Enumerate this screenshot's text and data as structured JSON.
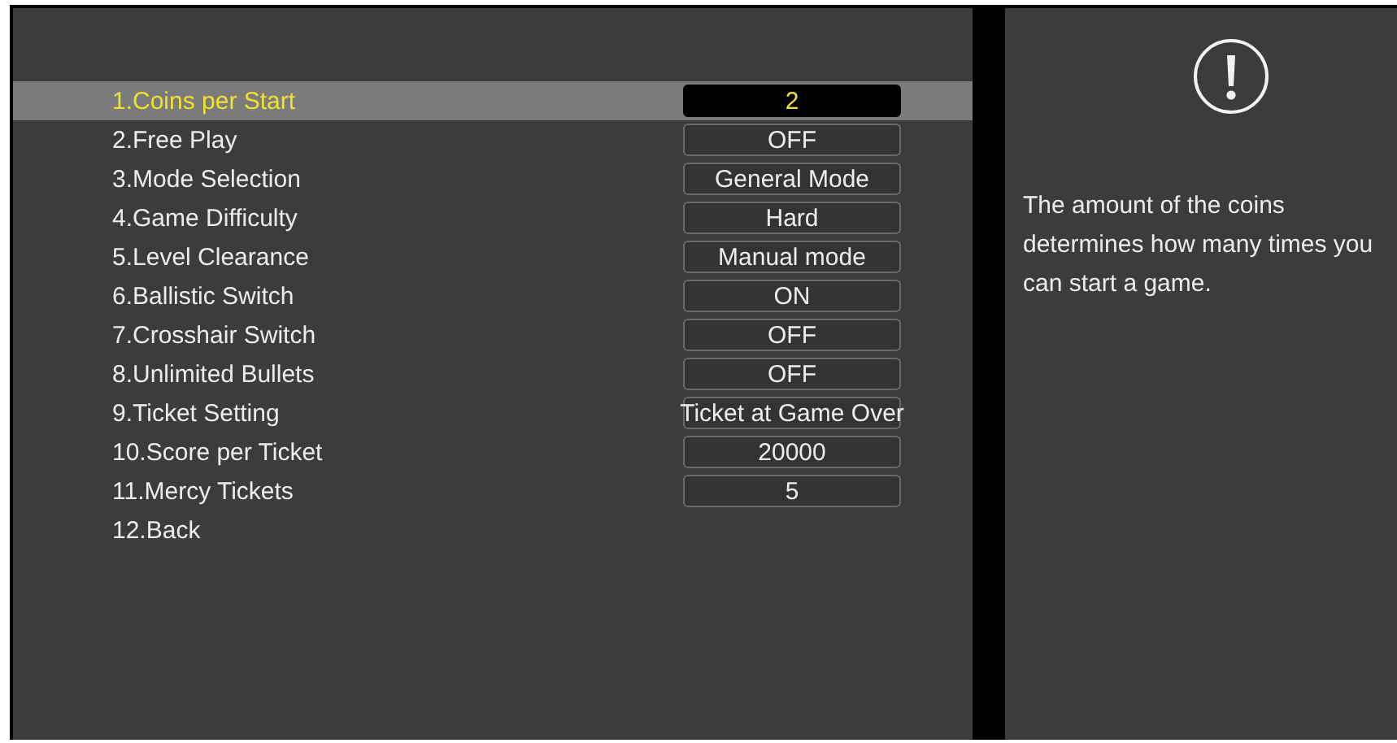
{
  "settings": [
    {
      "label": "1.Coins per Start",
      "value": "2",
      "selected": true
    },
    {
      "label": "2.Free Play",
      "value": "OFF",
      "selected": false
    },
    {
      "label": "3.Mode Selection",
      "value": "General Mode",
      "selected": false
    },
    {
      "label": "4.Game Difficulty",
      "value": "Hard",
      "selected": false
    },
    {
      "label": "5.Level Clearance",
      "value": "Manual mode",
      "selected": false
    },
    {
      "label": "6.Ballistic Switch",
      "value": "ON",
      "selected": false
    },
    {
      "label": "7.Crosshair Switch",
      "value": "OFF",
      "selected": false
    },
    {
      "label": "8.Unlimited Bullets",
      "value": "OFF",
      "selected": false
    },
    {
      "label": "9.Ticket Setting",
      "value": "Ticket at Game Over",
      "selected": false
    },
    {
      "label": "10.Score per Ticket",
      "value": "20000",
      "selected": false
    },
    {
      "label": "11.Mercy Tickets",
      "value": "5",
      "selected": false
    },
    {
      "label": "12.Back",
      "selected": false
    }
  ],
  "help": {
    "text": "The amount of the coins determines how many times you can start a game."
  }
}
